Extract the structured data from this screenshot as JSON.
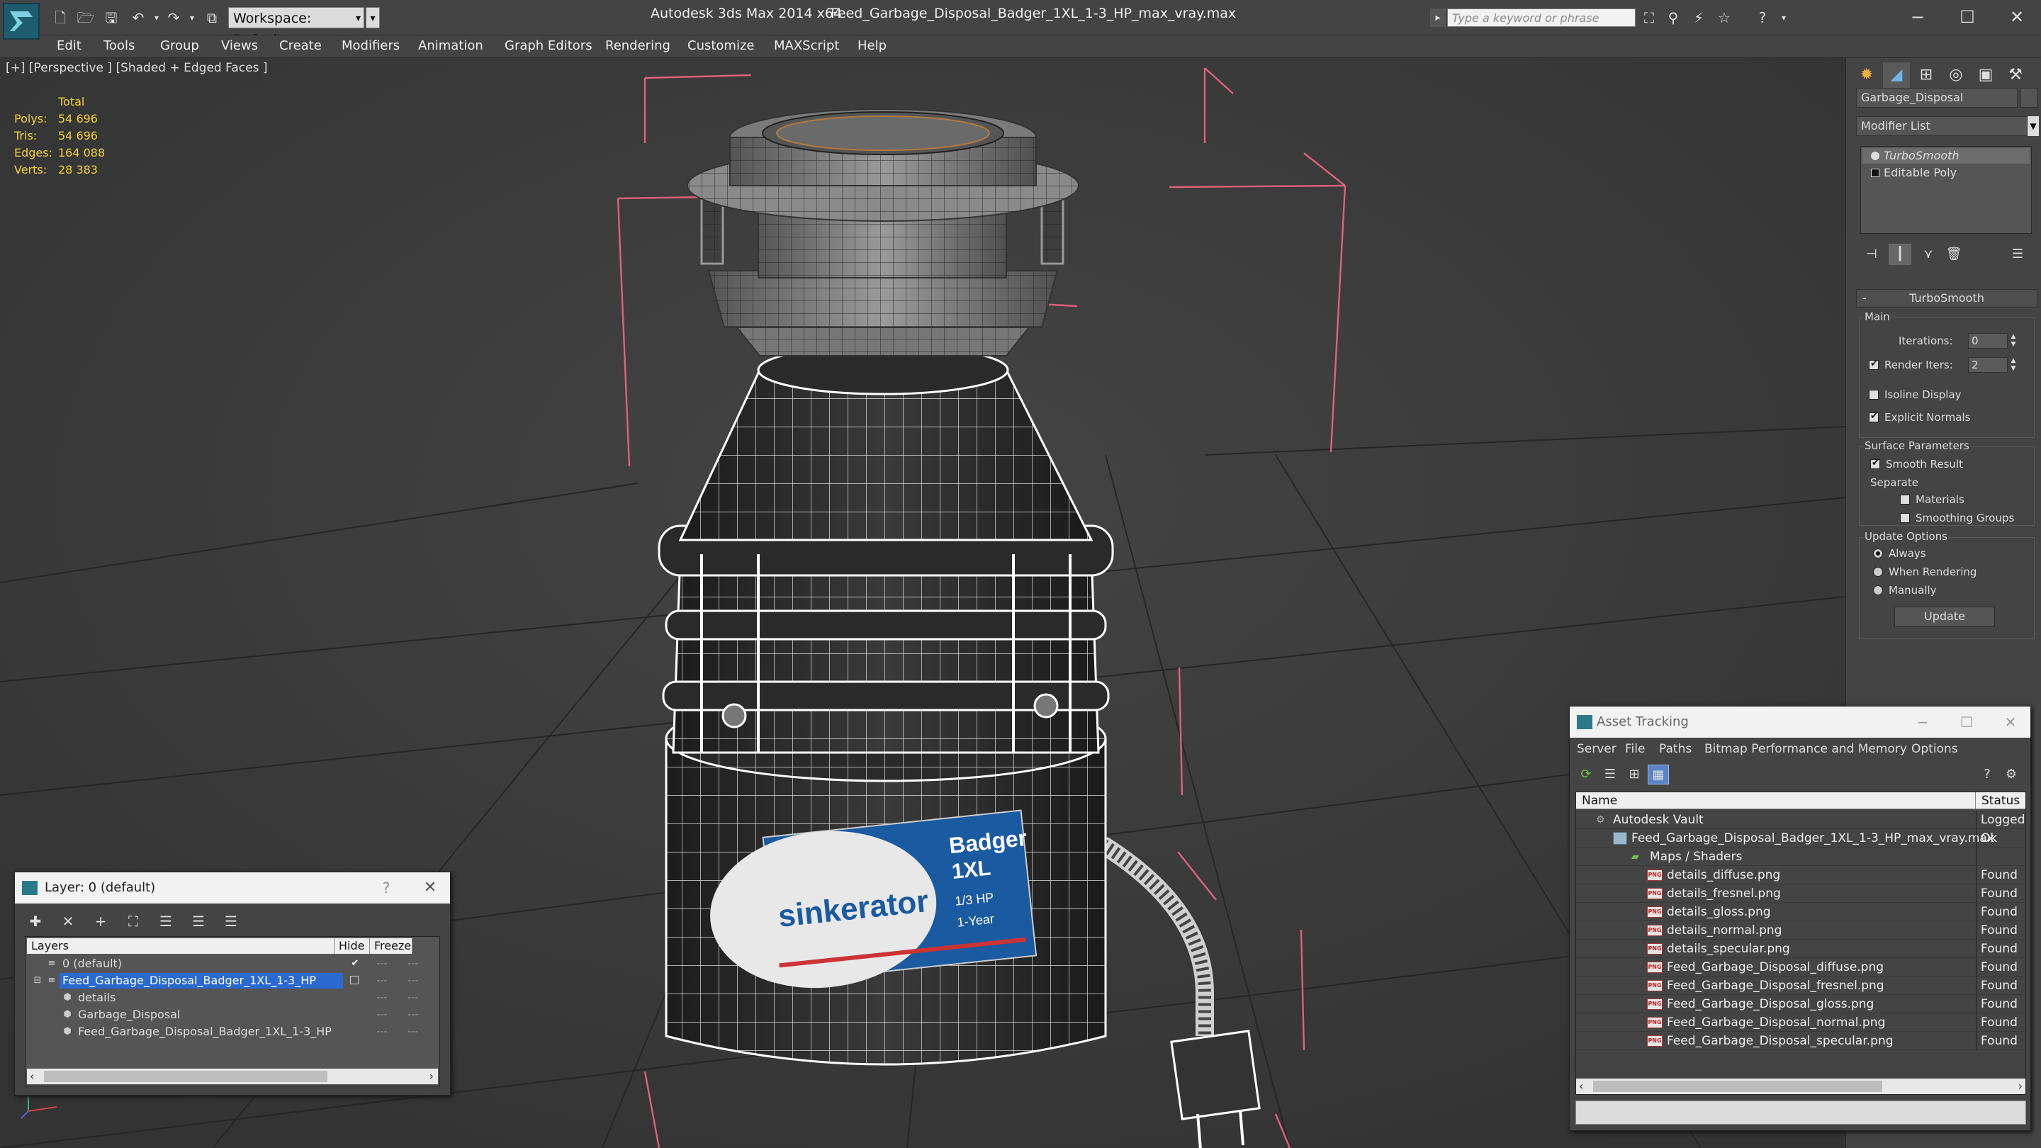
{
  "titlebar": {
    "workspace": "Workspace: Default",
    "app_title": "Autodesk 3ds Max  2014 x64",
    "doc_title": "Feed_Garbage_Disposal_Badger_1XL_1-3_HP_max_vray.max",
    "search_placeholder": "Type a keyword or phrase"
  },
  "menu": [
    "Edit",
    "Tools",
    "Group",
    "Views",
    "Create",
    "Modifiers",
    "Animation",
    "Graph Editors",
    "Rendering",
    "Customize",
    "MAXScript",
    "Help"
  ],
  "viewport": {
    "label": "[+] [Perspective ] [Shaded + Edged Faces ]",
    "stats": {
      "header": "Total",
      "rows": [
        {
          "label": "Polys:",
          "value": "54 696"
        },
        {
          "label": "Tris:",
          "value": "54 696"
        },
        {
          "label": "Edges:",
          "value": "164 088"
        },
        {
          "label": "Verts:",
          "value": "28 383"
        }
      ]
    },
    "product_label": {
      "brand": "sinkerator",
      "model_line1": "Badger",
      "model_line2": "1XL",
      "hp": "1/3 HP",
      "warranty": "1-Year"
    }
  },
  "command_panel": {
    "object_name": "Garbage_Disposal",
    "modifier_list": "Modifier List",
    "stack": [
      "TurboSmooth",
      "Editable Poly"
    ],
    "rollout_title": "TurboSmooth",
    "main_group": "Main",
    "iterations_label": "Iterations:",
    "iterations_value": "0",
    "render_iters_label": "Render Iters:",
    "render_iters_value": "2",
    "isoline_display": "Isoline Display",
    "explicit_normals": "Explicit Normals",
    "surface_group": "Surface Parameters",
    "smooth_result": "Smooth Result",
    "separate_label": "Separate",
    "materials": "Materials",
    "smoothing_groups": "Smoothing Groups",
    "update_group": "Update Options",
    "always": "Always",
    "when_rendering": "When Rendering",
    "manually": "Manually",
    "update_btn": "Update"
  },
  "layer_dialog": {
    "title": "Layer: 0 (default)",
    "help": "?",
    "columns": [
      "Layers",
      "Hide",
      "Freeze"
    ],
    "rows": [
      {
        "name": "0 (default)"
      },
      {
        "name": "Feed_Garbage_Disposal_Badger_1XL_1-3_HP"
      },
      {
        "name": "details"
      },
      {
        "name": "Garbage_Disposal"
      },
      {
        "name": "Feed_Garbage_Disposal_Badger_1XL_1-3_HP"
      }
    ]
  },
  "asset_dialog": {
    "title": "Asset Tracking",
    "menu": [
      "Server",
      "File",
      "Paths",
      "Bitmap Performance and Memory",
      "Options"
    ],
    "columns": [
      "Name",
      "Status"
    ],
    "rows": [
      {
        "name": "Autodesk Vault",
        "status": "Logged O"
      },
      {
        "name": "Feed_Garbage_Disposal_Badger_1XL_1-3_HP_max_vray.max",
        "status": "Ok"
      },
      {
        "name": "Maps / Shaders",
        "status": ""
      },
      {
        "name": "details_diffuse.png",
        "status": "Found"
      },
      {
        "name": "details_fresnel.png",
        "status": "Found"
      },
      {
        "name": "details_gloss.png",
        "status": "Found"
      },
      {
        "name": "details_normal.png",
        "status": "Found"
      },
      {
        "name": "details_specular.png",
        "status": "Found"
      },
      {
        "name": "Feed_Garbage_Disposal_diffuse.png",
        "status": "Found"
      },
      {
        "name": "Feed_Garbage_Disposal_fresnel.png",
        "status": "Found"
      },
      {
        "name": "Feed_Garbage_Disposal_gloss.png",
        "status": "Found"
      },
      {
        "name": "Feed_Garbage_Disposal_normal.png",
        "status": "Found"
      },
      {
        "name": "Feed_Garbage_Disposal_specular.png",
        "status": "Found"
      }
    ]
  },
  "colors": {
    "stats_text": "#f2d23a",
    "selection_blue": "#2a6ad0",
    "bbox_pink": "#e0607e",
    "wire_white": "#ffffff"
  }
}
